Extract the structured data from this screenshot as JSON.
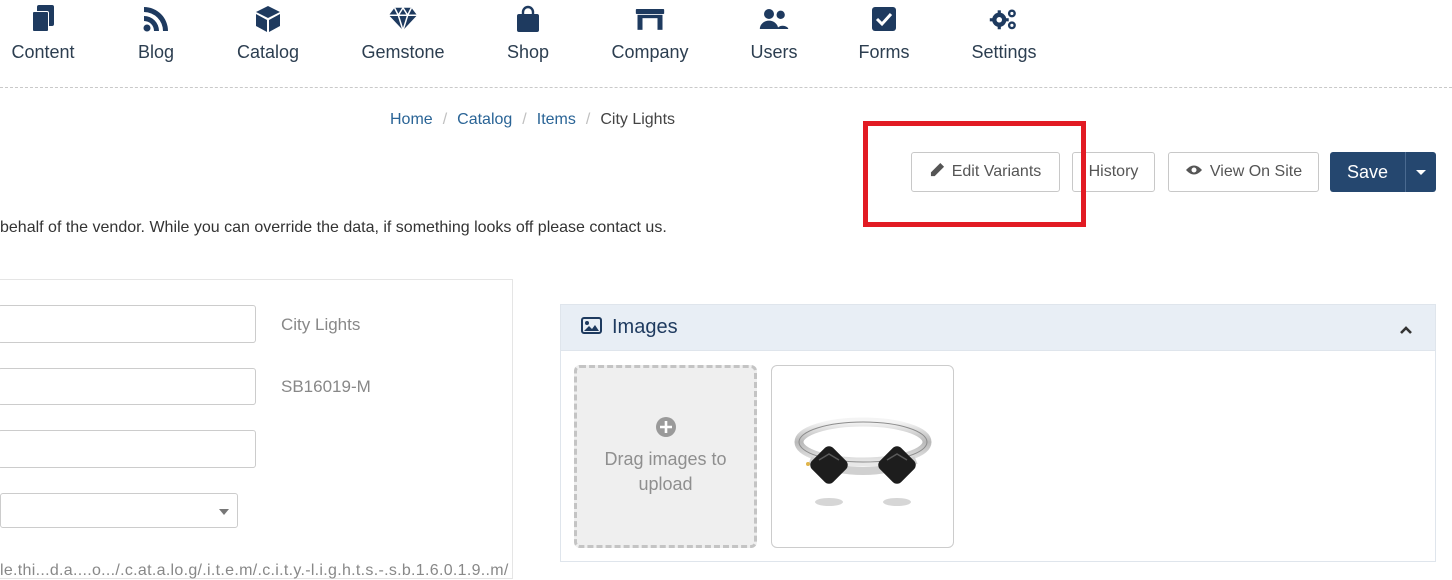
{
  "nav": {
    "items": [
      {
        "label": "Content",
        "icon": "content-icon"
      },
      {
        "label": "Blog",
        "icon": "rss-icon"
      },
      {
        "label": "Catalog",
        "icon": "cube-icon"
      },
      {
        "label": "Gemstone",
        "icon": "diamond-icon"
      },
      {
        "label": "Shop",
        "icon": "shopping-bag-icon"
      },
      {
        "label": "Company",
        "icon": "storefront-icon"
      },
      {
        "label": "Users",
        "icon": "users-icon"
      },
      {
        "label": "Forms",
        "icon": "checkbox-icon"
      },
      {
        "label": "Settings",
        "icon": "gears-icon"
      }
    ]
  },
  "breadcrumb": {
    "items": [
      "Home",
      "Catalog",
      "Items"
    ],
    "current": "City Lights",
    "separator": "/"
  },
  "actions": {
    "edit_variants": "Edit Variants",
    "history": "History",
    "view_on_site": "View On Site",
    "save": "Save"
  },
  "notice": "behalf of the vendor. While you can override the data, if something looks off please contact us.",
  "form": {
    "name_hint": "City Lights",
    "sku_hint": "SB16019-M",
    "cutoff_text": "le.thi...d.a....o.../.c.at.a.lo.g/.i.t.e.m/.c.i.t.y.-l.i.g.h.t.s.-.s.b.1.6.0.1.9..m/"
  },
  "images": {
    "title": "Images",
    "dropzone_text": "Drag images to upload"
  },
  "colors": {
    "brand": "#25476f",
    "link": "#2a6496",
    "highlight": "#e21b23",
    "panel_header": "#e8eef5"
  }
}
